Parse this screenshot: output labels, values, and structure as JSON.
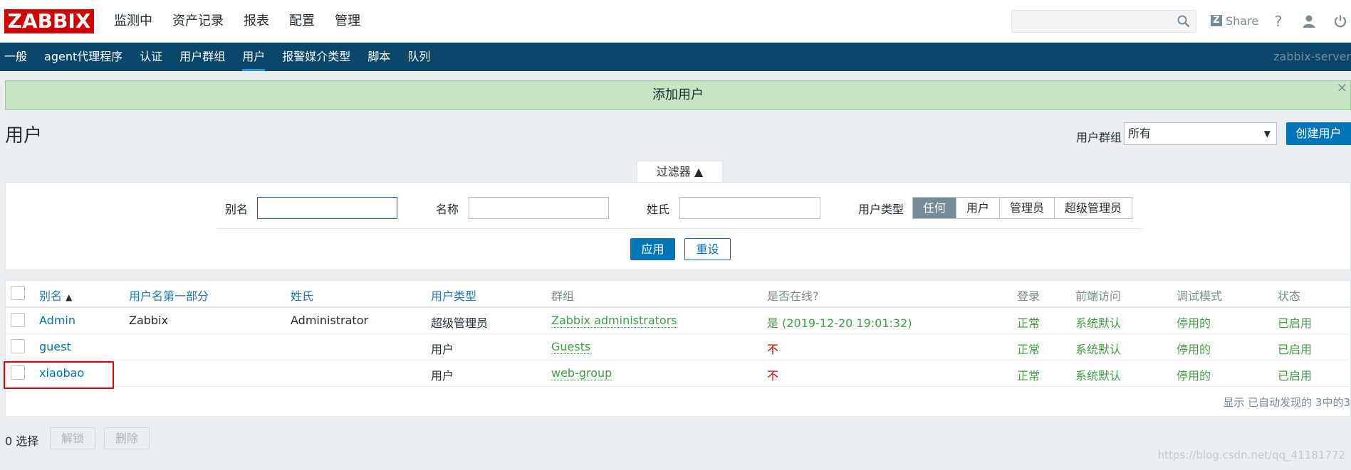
{
  "header": {
    "logo": "ZABBIX",
    "menu": [
      "监测中",
      "资产记录",
      "报表",
      "配置",
      "管理"
    ],
    "share_label": "Share",
    "share_z": "Z",
    "help": "?"
  },
  "subnav": {
    "items": [
      "一般",
      "agent代理程序",
      "认证",
      "用户群组",
      "用户",
      "报警媒介类型",
      "脚本",
      "队列"
    ],
    "active": "用户",
    "server": "zabbix-server"
  },
  "message": {
    "text": "添加用户",
    "close": "×"
  },
  "page": {
    "title": "用户",
    "group_label": "用户群组",
    "group_value": "所有",
    "create_button": "创建用户"
  },
  "filter": {
    "tab_label": "过滤器",
    "tab_arrow": "▲",
    "alias_label": "别名",
    "alias_value": "",
    "name_label": "名称",
    "name_value": "",
    "surname_label": "姓氏",
    "surname_value": "",
    "type_label": "用户类型",
    "type_options": [
      "任何",
      "用户",
      "管理员",
      "超级管理员"
    ],
    "type_selected": "任何",
    "apply_button": "应用",
    "reset_button": "重设"
  },
  "table": {
    "headers": {
      "alias": "别名",
      "sort_arrow": "▲",
      "name": "用户名第一部分",
      "surname": "姓氏",
      "type": "用户类型",
      "groups": "群组",
      "online": "是否在线?",
      "login": "登录",
      "frontend": "前端访问",
      "debug": "调试模式",
      "status": "状态"
    },
    "rows": [
      {
        "alias": "Admin",
        "name": "Zabbix",
        "surname": "Administrator",
        "type": "超级管理员",
        "groups": "Zabbix administrators",
        "online": "是 (2019-12-20 19:01:32)",
        "login": "正常",
        "frontend": "系统默认",
        "debug": "停用的",
        "status": "已启用"
      },
      {
        "alias": "guest",
        "name": "",
        "surname": "",
        "type": "用户",
        "groups": "Guests",
        "online": "不",
        "login": "正常",
        "frontend": "系统默认",
        "debug": "停用的",
        "status": "已启用"
      },
      {
        "alias": "xiaobao",
        "name": "",
        "surname": "",
        "type": "用户",
        "groups": "web-group",
        "online": "不",
        "login": "正常",
        "frontend": "系统默认",
        "debug": "停用的",
        "status": "已启用"
      }
    ],
    "footer": "显示 已自动发现的 3中的3"
  },
  "actions": {
    "selected": "0 选择",
    "unblock": "解锁",
    "delete": "删除"
  },
  "watermark": "https://blog.csdn.net/qq_41181772",
  "colors": {
    "brand": "#d40000",
    "nav_bg": "#0a466a",
    "primary": "#0275b8",
    "success_bg": "#c5e5c5",
    "ok_green": "#429e47"
  },
  "icons": {
    "search": "search-icon",
    "user": "user-icon",
    "power": "power-icon",
    "help": "help-icon"
  }
}
